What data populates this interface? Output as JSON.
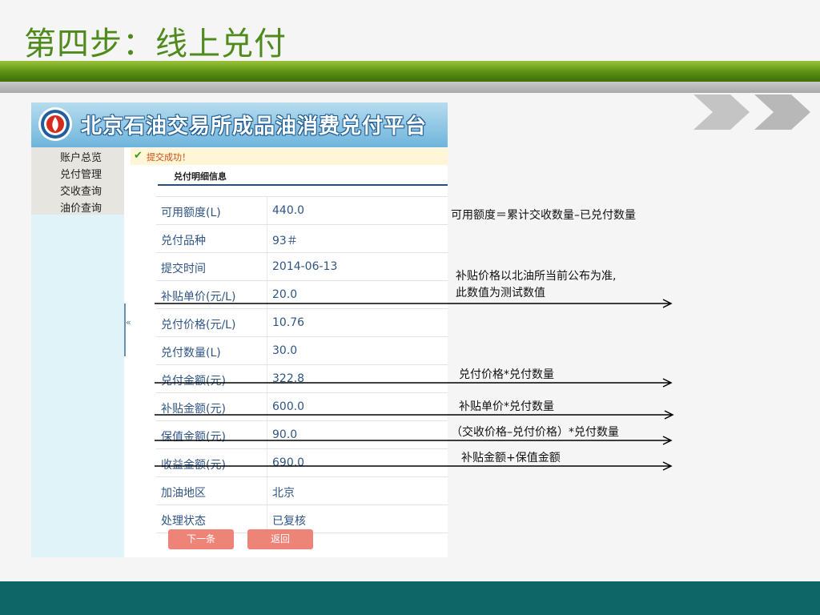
{
  "slide": {
    "title": "第四步：线上兑付"
  },
  "app": {
    "title": "北京石油交易所成品油消费兑付平台",
    "menu": [
      "账户总览",
      "兑付管理",
      "交收查询",
      "油价查询"
    ],
    "success_message": "提交成功！",
    "section_title": "兑付明细信息",
    "rows": [
      {
        "label": "可用额度(L)",
        "value": "440.0"
      },
      {
        "label": "兑付品种",
        "value": "93＃"
      },
      {
        "label": "提交时间",
        "value": "2014-06-13"
      },
      {
        "label": "补贴单价(元/L)",
        "value": "20.0"
      },
      {
        "label": "兑付价格(元/L)",
        "value": "10.76"
      },
      {
        "label": "兑付数量(L)",
        "value": "30.0"
      },
      {
        "label": "兑付金额(元)",
        "value": "322.8"
      },
      {
        "label": "补贴金额(元)",
        "value": "600.0"
      },
      {
        "label": "保值金额(元)",
        "value": "90.0"
      },
      {
        "label": "收益金额(元)",
        "value": "690.0"
      },
      {
        "label": "加油地区",
        "value": "北京"
      },
      {
        "label": "处理状态",
        "value": "已复核"
      }
    ],
    "buttons": {
      "next": "下一条",
      "back": "返回"
    },
    "collapse_glyph": "«"
  },
  "annotations": {
    "available_formula": "可用额度＝累计交收数量–已兑付数量",
    "subsidy_note_line1": "补贴价格以北油所当前公布为准,",
    "subsidy_note_line2": "此数值为测试数值",
    "amount_formula": "兑付价格*兑付数量",
    "subsidy_amount_formula": "补贴单价*兑付数量",
    "hedge_formula": "（交收价格–兑付价格）*兑付数量",
    "income_formula": "补贴金额+保值金额"
  },
  "colors": {
    "title_green": "#4f8a1c",
    "footer_teal": "#0e6666",
    "button_salmon": "#ee8478",
    "field_text": "#2f5585",
    "success_text": "#d14a10"
  }
}
